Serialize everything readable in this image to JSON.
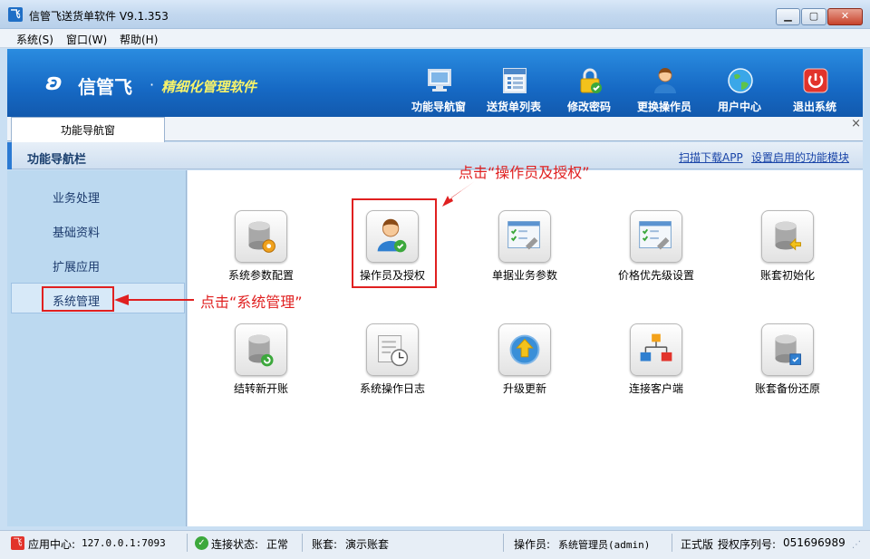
{
  "window": {
    "title": "信管飞送货单软件 V9.1.353"
  },
  "menu": [
    "系统(S)",
    "窗口(W)",
    "帮助(H)"
  ],
  "banner": {
    "logo_text": "信管飞",
    "slogan": "精细化管理软件"
  },
  "toolbar": [
    {
      "label": "功能导航窗",
      "icon": "monitor-icon"
    },
    {
      "label": "送货单列表",
      "icon": "list-icon"
    },
    {
      "label": "修改密码",
      "icon": "lock-icon"
    },
    {
      "label": "更换操作员",
      "icon": "user-icon"
    },
    {
      "label": "用户中心",
      "icon": "globe-icon"
    },
    {
      "label": "退出系统",
      "icon": "power-icon"
    }
  ],
  "tabs": [
    {
      "label": "功能导航窗"
    }
  ],
  "section": {
    "title": "功能导航栏",
    "link_app": "扫描下载APP",
    "link_modules": "设置启用的功能模块"
  },
  "sidebar": {
    "items": [
      {
        "label": "业务处理"
      },
      {
        "label": "基础资料"
      },
      {
        "label": "扩展应用"
      },
      {
        "label": "系统管理"
      }
    ],
    "selected": "系统管理"
  },
  "functions": [
    {
      "label": "系统参数配置",
      "icon": "database-gear-icon"
    },
    {
      "label": "操作员及授权",
      "icon": "operator-auth-icon"
    },
    {
      "label": "单据业务参数",
      "icon": "checklist-wrench-icon"
    },
    {
      "label": "价格优先级设置",
      "icon": "checklist-wrench-icon"
    },
    {
      "label": "账套初始化",
      "icon": "database-arrow-icon"
    },
    {
      "label": "结转新开账",
      "icon": "database-refresh-icon"
    },
    {
      "label": "系统操作日志",
      "icon": "log-clock-icon"
    },
    {
      "label": "升级更新",
      "icon": "upgrade-icon"
    },
    {
      "label": "连接客户端",
      "icon": "network-icon"
    },
    {
      "label": "账套备份还原",
      "icon": "database-backup-icon"
    }
  ],
  "annotations": {
    "operator": "点击“操作员及授权”",
    "system": "点击“系统管理”"
  },
  "status": {
    "app_center_label": "应用中心:",
    "app_center_value": "127.0.0.1:7093",
    "connection_label": "连接状态:",
    "connection_value": "正常",
    "account_label": "账套:",
    "account_value": "演示账套",
    "operator_label": "操作员:",
    "operator_value": "系统管理员(admin)",
    "edition": "正式版",
    "serial_label": "授权序列号:",
    "serial_value": "051696989"
  },
  "colors": {
    "accent": "#1669c4",
    "highlight": "#e02020",
    "slogan": "#f7f36a"
  }
}
